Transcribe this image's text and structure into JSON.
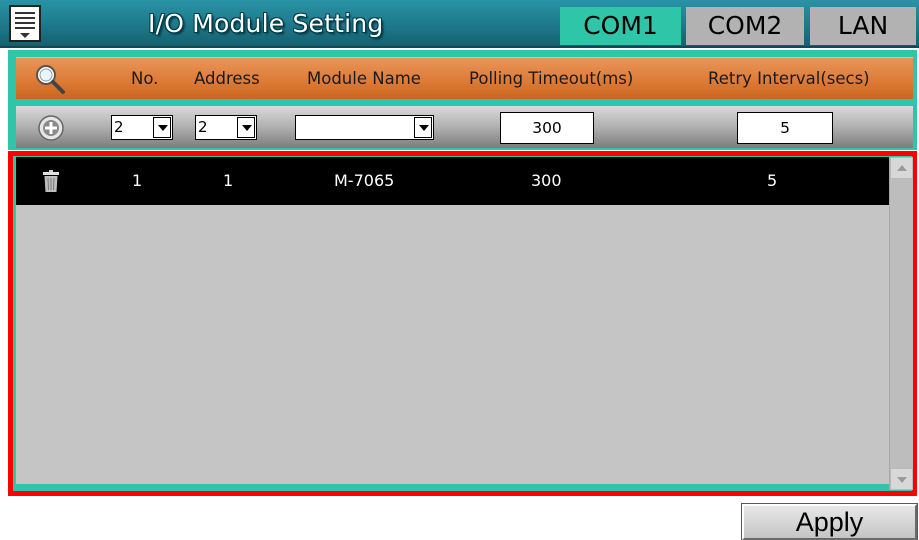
{
  "header": {
    "title": "I/O Module Setting",
    "tabs": [
      {
        "label": "COM1",
        "active": true
      },
      {
        "label": "COM2",
        "active": false
      },
      {
        "label": "LAN",
        "active": false
      }
    ]
  },
  "columns": {
    "no": "No.",
    "address": "Address",
    "module_name": "Module Name",
    "polling_timeout": "Polling Timeout(ms)",
    "retry_interval": "Retry Interval(secs)"
  },
  "inputs": {
    "no_value": "2",
    "address_value": "2",
    "module_name_value": "",
    "polling_timeout_value": "300",
    "retry_interval_value": "5"
  },
  "rows": [
    {
      "no": "1",
      "address": "1",
      "module_name": "M-7065",
      "polling_timeout": "300",
      "retry_interval": "5"
    }
  ],
  "apply_label": "Apply",
  "colors": {
    "titlebar": "#1d7688",
    "active_tab": "#2fc5a8",
    "inactive_tab": "#b2b2b2",
    "header_row": "#de7c38",
    "selection_border": "#ff0000"
  }
}
